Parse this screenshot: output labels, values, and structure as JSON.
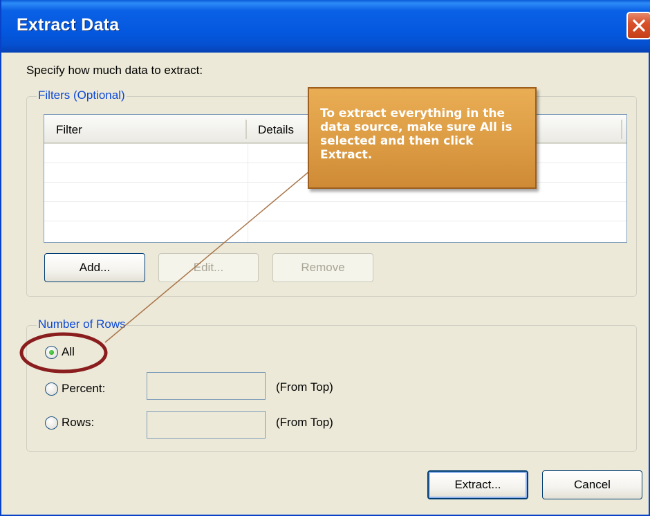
{
  "window": {
    "title": "Extract Data"
  },
  "prompt": "Specify how much data to extract:",
  "filters": {
    "legend": "Filters (Optional)",
    "columns": [
      "Filter",
      "Details"
    ],
    "buttons": {
      "add": "Add...",
      "edit": "Edit...",
      "remove": "Remove"
    }
  },
  "rows": {
    "legend": "Number of Rows",
    "options": [
      {
        "label": "All",
        "selected": true
      },
      {
        "label": "Percent:",
        "selected": false,
        "value": "",
        "suffix": "(From Top)"
      },
      {
        "label": "Rows:",
        "selected": false,
        "value": "",
        "suffix": "(From Top)"
      }
    ]
  },
  "footer": {
    "extract": "Extract...",
    "cancel": "Cancel"
  },
  "callout": {
    "text": "To extract everything in the data source, make sure All is selected and then click Extract."
  },
  "colors": {
    "titlebar": "#0458df",
    "dialog_bg": "#ece9d8",
    "legend_text": "#0a46d6",
    "callout_bg": "#dc9c44",
    "highlight_ellipse": "#8a1d1d"
  }
}
